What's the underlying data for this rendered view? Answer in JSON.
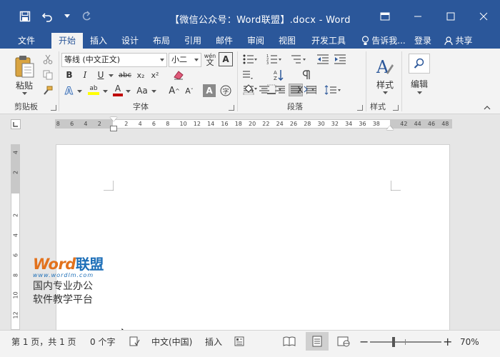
{
  "window": {
    "title": "【微信公众号：Word联盟】.docx - Word",
    "qat_icons": [
      "save-icon",
      "undo-icon",
      "redo-icon"
    ],
    "controls": [
      "ribbon-display-icon",
      "minimize-icon",
      "maximize-icon",
      "close-icon"
    ]
  },
  "tabs": {
    "items": [
      "文件",
      "开始",
      "插入",
      "设计",
      "布局",
      "引用",
      "邮件",
      "审阅",
      "视图",
      "开发工具"
    ],
    "active": "开始",
    "tell_me": "告诉我...",
    "signin": "登录",
    "share": "共享"
  },
  "ribbon": {
    "clipboard": {
      "label": "剪贴板",
      "paste": "粘贴"
    },
    "font": {
      "label": "字体",
      "font_name": "等线 (中文正文)",
      "font_size": "小二",
      "phonetic": "wén",
      "buttons": [
        "B",
        "I",
        "U",
        "abc",
        "x₂",
        "x²",
        "Aa"
      ]
    },
    "paragraph": {
      "label": "段落"
    },
    "styles": {
      "label": "样式",
      "button": "样式"
    },
    "editing": {
      "button": "编辑"
    },
    "accent_color": "#2b579a",
    "font_color": "#c00000",
    "highlight_color": "#ffff00"
  },
  "ruler": {
    "left_numbers": [
      "8",
      "6",
      "4",
      "2"
    ],
    "numbers": [
      "2",
      "4",
      "6",
      "8",
      "10",
      "12",
      "14",
      "16",
      "18",
      "20",
      "22",
      "24",
      "26",
      "28",
      "30",
      "32",
      "34",
      "36",
      "38"
    ],
    "right_numbers": [
      "42",
      "44",
      "46",
      "48"
    ],
    "vertical_numbers": [
      "4",
      "2",
      "2",
      "4",
      "6",
      "8",
      "10",
      "12"
    ]
  },
  "watermark": {
    "logo_word": "Word",
    "logo_cn": "联盟",
    "url": "www.wordlm.com",
    "line1": "国内专业办公",
    "line2": "软件教学平台"
  },
  "statusbar": {
    "page": "第 1 页，共 1 页",
    "words": "0 个字",
    "language": "中文(中国)",
    "mode": "插入",
    "zoom": "70%",
    "zoom_level": 0.7
  }
}
